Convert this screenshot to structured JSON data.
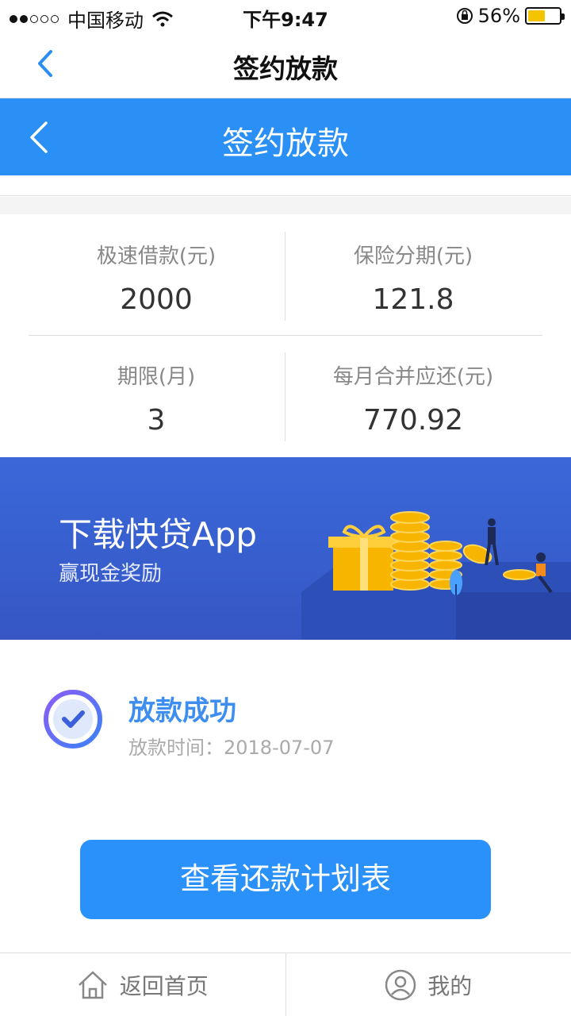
{
  "status_bar": {
    "carrier": "中国移动",
    "time": "下午9:47",
    "battery": "56%",
    "battery_level": 0.56
  },
  "nav_top": {
    "title": "签约放款"
  },
  "nav_overlay": {
    "title": "签约放款"
  },
  "summary": {
    "loan_label": "极速借款(元)",
    "loan_value": "2000",
    "insurance_label": "保险分期(元)",
    "insurance_value": "121.8",
    "term_label": "期限(月)",
    "term_value": "3",
    "monthly_label": "每月合并应还(元)",
    "monthly_value": "770.92"
  },
  "banner": {
    "title": "下载快贷App",
    "subtitle": "赢现金奖励"
  },
  "result": {
    "title": "放款成功",
    "time": "放款时间：2018-07-07"
  },
  "primary_button": {
    "label": "查看还款计划表"
  },
  "tabbar": {
    "home_label": "返回首页",
    "mine_label": "我的"
  },
  "colors": {
    "accent": "#2b90f6",
    "banner": "#3a68d9",
    "success": "#3d8ef0"
  },
  "icons": [
    "wifi-icon",
    "lock-rotation-icon",
    "battery-icon",
    "back-chevron-icon",
    "check-circle-icon",
    "home-icon",
    "user-icon"
  ]
}
